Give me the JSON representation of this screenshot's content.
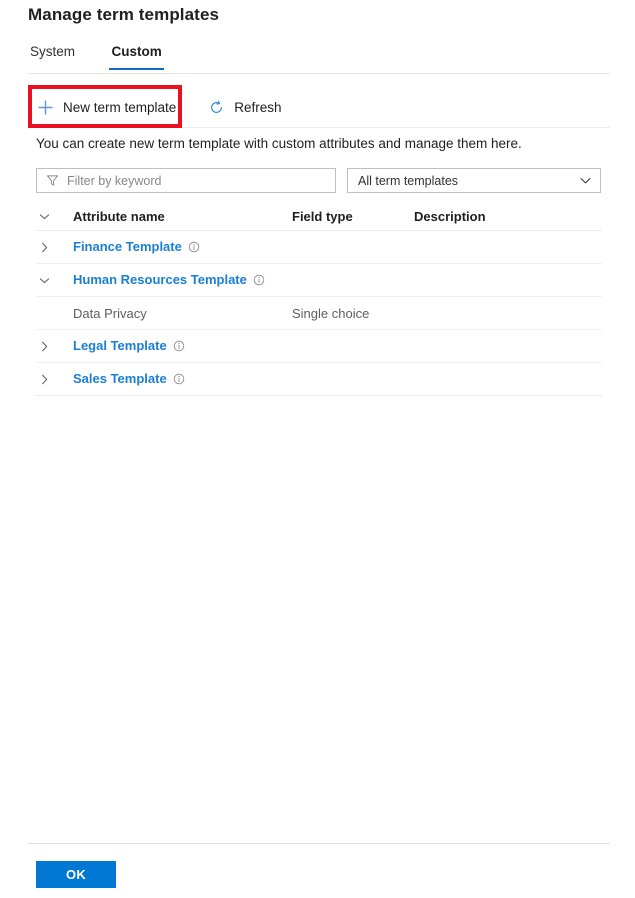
{
  "dialog": {
    "title": "Manage term templates"
  },
  "tabs": [
    {
      "label": "System",
      "active": false
    },
    {
      "label": "Custom",
      "active": true
    }
  ],
  "commandbar": {
    "new_template_label": "New term template",
    "new_template_icon": "plus-icon",
    "refresh_label": "Refresh",
    "refresh_icon": "refresh-icon"
  },
  "highlight": {
    "color": "#e81123",
    "target": "new-term-template-button"
  },
  "helper_text": "You can create new term template with custom attributes and manage them here.",
  "filters": {
    "search": {
      "placeholder": "Filter by keyword",
      "value": "",
      "icon": "filter-icon"
    },
    "template_select": {
      "value": "All term templates",
      "icon": "chevron-down-icon"
    }
  },
  "table": {
    "columns": [
      {
        "key": "name",
        "label": "Attribute name"
      },
      {
        "key": "type",
        "label": "Field type"
      },
      {
        "key": "desc",
        "label": "Description"
      }
    ],
    "header_chevron": "chevron-down-icon",
    "rows": [
      {
        "kind": "template",
        "name": "Finance Template",
        "chevron": "chevron-right-icon",
        "expanded": false,
        "info_icon": "info-icon",
        "type": "",
        "desc": ""
      },
      {
        "kind": "template",
        "name": "Human Resources Template",
        "chevron": "chevron-down-icon",
        "expanded": true,
        "info_icon": "info-icon",
        "type": "",
        "desc": ""
      },
      {
        "kind": "attribute",
        "name": "Data Privacy",
        "chevron": "",
        "expanded": false,
        "info_icon": "",
        "type": "Single choice",
        "desc": ""
      },
      {
        "kind": "template",
        "name": "Legal Template",
        "chevron": "chevron-right-icon",
        "expanded": false,
        "info_icon": "info-icon",
        "type": "",
        "desc": ""
      },
      {
        "kind": "template",
        "name": "Sales Template",
        "chevron": "chevron-right-icon",
        "expanded": false,
        "info_icon": "info-icon",
        "type": "",
        "desc": ""
      }
    ]
  },
  "footer": {
    "ok_label": "OK"
  },
  "colors": {
    "accent": "#0078d4",
    "link": "#1a7fd4",
    "tab_underline": "#0f6cbd",
    "highlight": "#e81123"
  }
}
